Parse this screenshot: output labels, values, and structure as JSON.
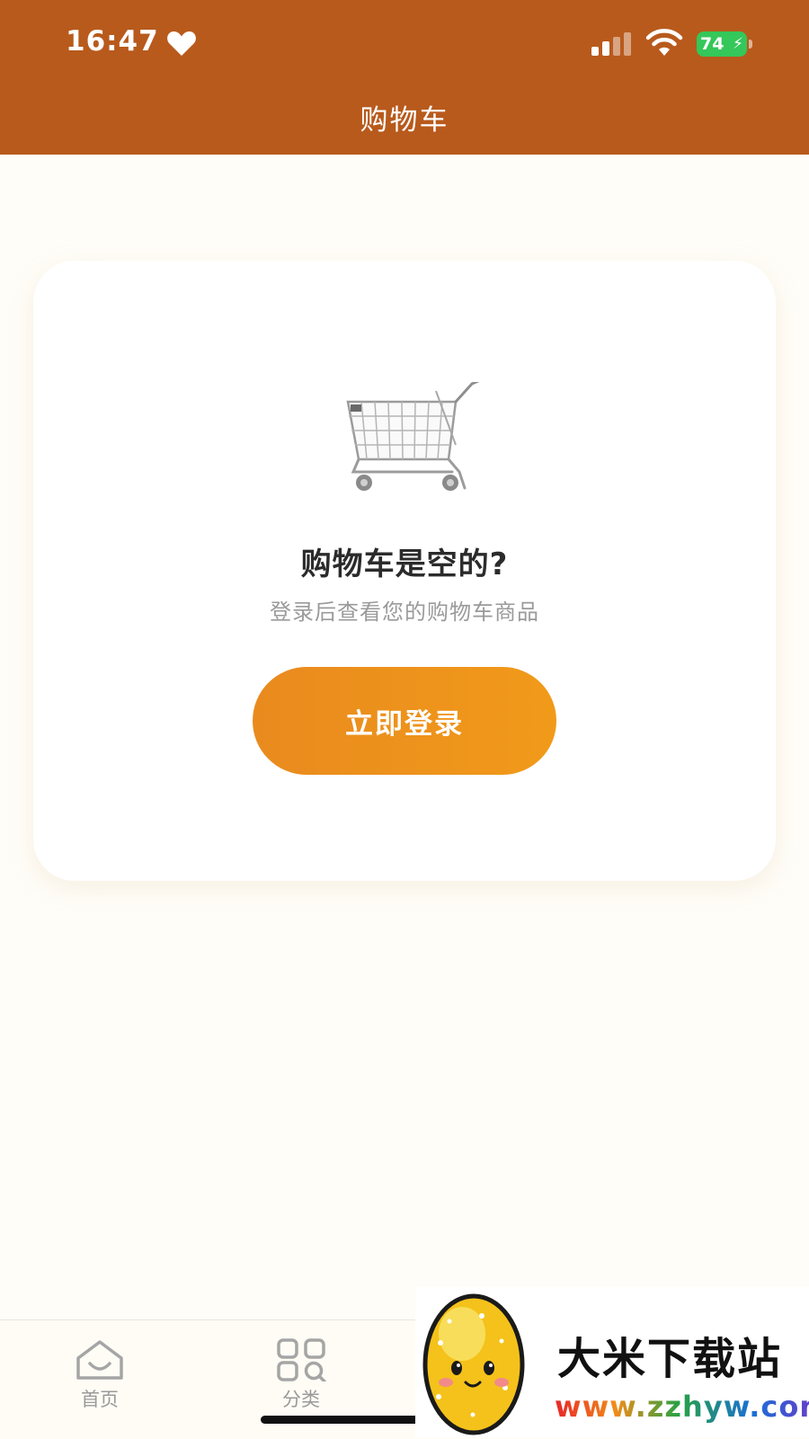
{
  "status_bar": {
    "time": "16:47",
    "battery_level": "74",
    "heart_icon": "heart-icon",
    "signal_icon": "cellular-signal-icon",
    "wifi_icon": "wifi-icon",
    "battery_charging_icon": "lightning-icon"
  },
  "header": {
    "title": "购物车",
    "background_color": "#b85a1c"
  },
  "empty_state": {
    "illustration": "shopping-cart-icon",
    "title": "购物车是空的?",
    "subtitle": "登录后查看您的购物车商品",
    "button_label": "立即登录",
    "button_color": "#f0961c"
  },
  "bottom_nav": {
    "items": [
      {
        "label": "首页",
        "icon": "home-icon"
      },
      {
        "label": "分类",
        "icon": "category-grid-icon"
      }
    ]
  },
  "watermark": {
    "title": "大米下载站",
    "url": "www.zzhyw.com"
  },
  "colors": {
    "page_background": "#fffdf8",
    "accent": "#f0961c",
    "battery_green": "#34c759"
  }
}
